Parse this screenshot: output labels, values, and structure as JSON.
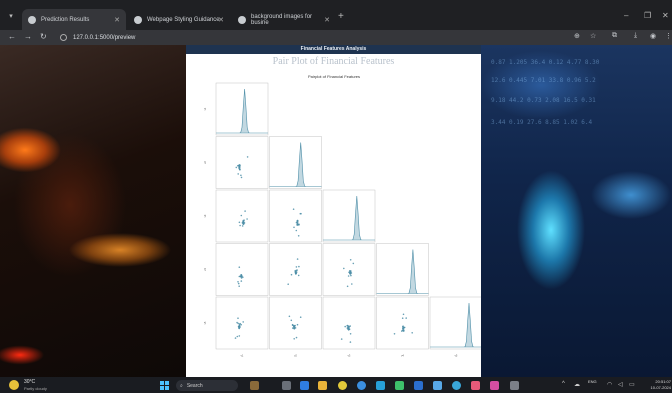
{
  "tabs": [
    {
      "title": "Prediction Results",
      "active": true
    },
    {
      "title": "Webpage Styling Guidance",
      "active": false
    },
    {
      "title": "background images for busine",
      "active": false
    }
  ],
  "address": {
    "url": "127.0.0.1:5000/preview"
  },
  "page": {
    "banner": "Financial Features Analysis",
    "title": "Pair Plot of Financial Features"
  },
  "chart_data": {
    "type": "scatter",
    "kind": "pairplot",
    "title": "Pairplot of Financial Features",
    "variables": [
      "v1",
      "v2",
      "v3",
      "v4",
      "v5"
    ],
    "diagonal": "kde",
    "layout": "lower-triangle",
    "color": "#4f8fa8"
  },
  "taskbar": {
    "temperature": "30°C",
    "weather": "Partly cloudy",
    "search_label": "Search",
    "language": "ENG",
    "time": "20:51:07",
    "date": "10-07-2024"
  },
  "colors": {
    "banner": "#1e3350",
    "accent": "#4cc2ff",
    "marker": "#4f8fa8"
  }
}
